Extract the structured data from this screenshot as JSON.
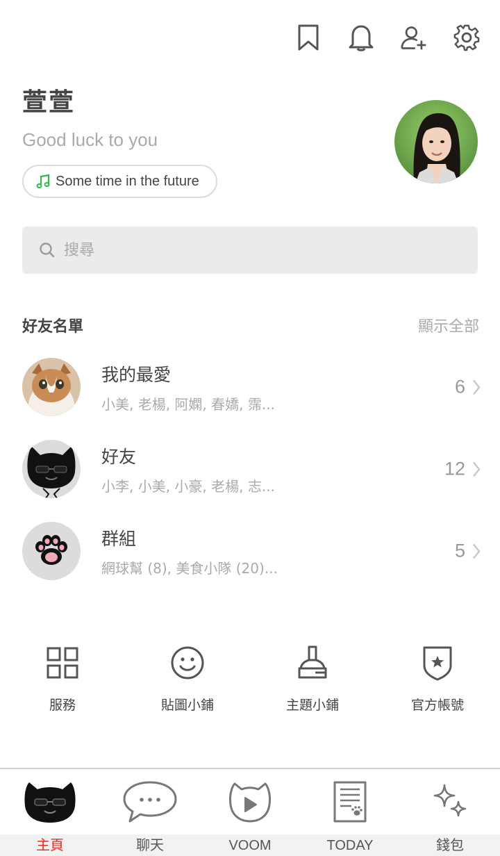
{
  "topbar": {
    "icons": [
      "bookmark-icon",
      "bell-icon",
      "add-friend-icon",
      "settings-icon"
    ]
  },
  "profile": {
    "name": "萱萱",
    "status": "Good luck to you",
    "music": "Some time in the future",
    "accent": "#2db84d"
  },
  "search": {
    "placeholder": "搜尋"
  },
  "friends": {
    "title": "好友名單",
    "show_all": "顯示全部",
    "rows": [
      {
        "name": "我的最愛",
        "members": "小美, 老楊, 阿嫻, 春嬌, 霈...",
        "count": "6"
      },
      {
        "name": "好友",
        "members": "小李, 小美, 小豪, 老楊, 志...",
        "count": "12"
      },
      {
        "name": "群組",
        "members": "網球幫 (8), 美食小隊 (20)...",
        "count": "5"
      }
    ]
  },
  "shortcuts": [
    {
      "label": "服務",
      "icon": "grid-icon"
    },
    {
      "label": "貼圖小鋪",
      "icon": "smiley-icon"
    },
    {
      "label": "主題小鋪",
      "icon": "brush-icon"
    },
    {
      "label": "官方帳號",
      "icon": "shield-star-icon"
    }
  ],
  "bottom_nav": {
    "active_color": "#e0302b",
    "items": [
      {
        "label": "主頁",
        "icon": "home-cat-icon",
        "active": true
      },
      {
        "label": "聊天",
        "icon": "chat-bubble-icon",
        "active": false
      },
      {
        "label": "VOOM",
        "icon": "voom-play-icon",
        "active": false
      },
      {
        "label": "TODAY",
        "icon": "news-icon",
        "active": false
      },
      {
        "label": "錢包",
        "icon": "sparkle-icon",
        "active": false
      }
    ]
  }
}
